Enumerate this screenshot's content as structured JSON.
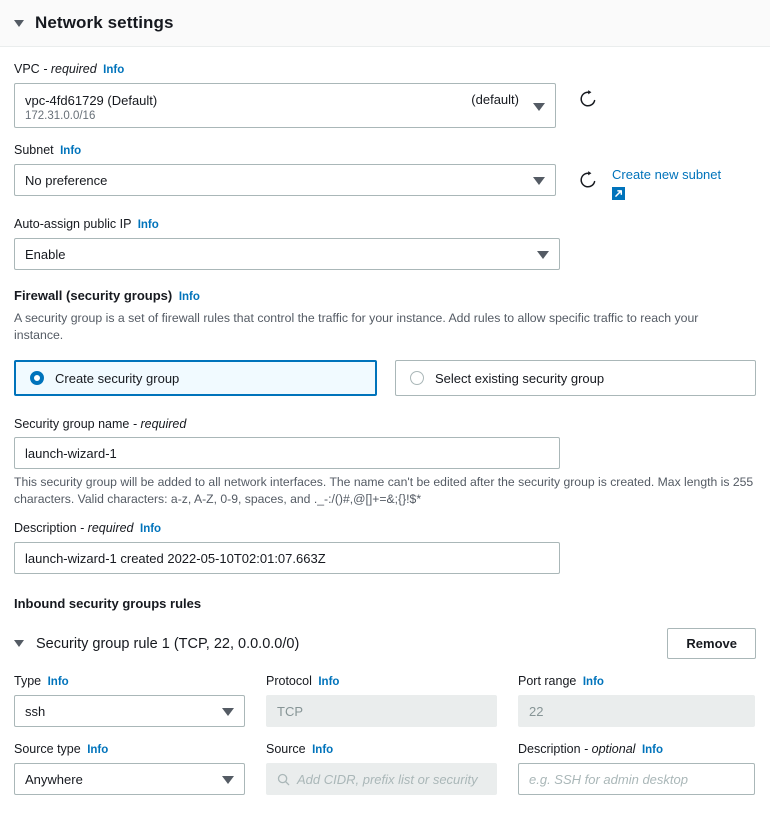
{
  "section": {
    "title": "Network settings",
    "collapse_icon": "caret-down-icon"
  },
  "vpc": {
    "label": "VPC",
    "required_suffix": "- required",
    "info": "Info",
    "value_line1": "vpc-4fd61729 (Default)",
    "value_line2": "172.31.0.0/16",
    "default_tag": "(default)",
    "refresh_icon": "refresh-icon"
  },
  "subnet": {
    "label": "Subnet",
    "info": "Info",
    "value": "No preference",
    "refresh_icon": "refresh-icon",
    "create_link": "Create new subnet",
    "external_icon": "external-link-icon"
  },
  "auto_assign_ip": {
    "label": "Auto-assign public IP",
    "info": "Info",
    "value": "Enable"
  },
  "firewall": {
    "label": "Firewall (security groups)",
    "info": "Info",
    "description": "A security group is a set of firewall rules that control the traffic for your instance. Add rules to allow specific traffic to reach your instance.",
    "options": [
      {
        "label": "Create security group",
        "selected": true
      },
      {
        "label": "Select existing security group",
        "selected": false
      }
    ]
  },
  "security_group_name": {
    "label": "Security group name",
    "required_suffix": "- required",
    "value": "launch-wizard-1",
    "hint": "This security group will be added to all network interfaces. The name can't be edited after the security group is created. Max length is 255 characters. Valid characters: a-z, A-Z, 0-9, spaces, and ._-:/()#,@[]+=&;{}!$*"
  },
  "description_field": {
    "label": "Description",
    "required_suffix": "- required",
    "info": "Info",
    "value": "launch-wizard-1 created 2022-05-10T02:01:07.663Z"
  },
  "inbound_rules": {
    "heading": "Inbound security groups rules",
    "rule": {
      "title": "Security group rule 1 (TCP, 22, 0.0.0.0/0)",
      "collapse_icon": "caret-down-icon",
      "remove_label": "Remove",
      "fields": {
        "type": {
          "label": "Type",
          "info": "Info",
          "value": "ssh",
          "control": "select"
        },
        "protocol": {
          "label": "Protocol",
          "info": "Info",
          "value": "TCP",
          "control": "disabled-input"
        },
        "port_range": {
          "label": "Port range",
          "info": "Info",
          "value": "22",
          "control": "disabled-input"
        },
        "source_type": {
          "label": "Source type",
          "info": "Info",
          "value": "Anywhere",
          "control": "select"
        },
        "source": {
          "label": "Source",
          "info": "Info",
          "placeholder": "Add CIDR, prefix list or security",
          "control": "search-input",
          "icon": "search-icon"
        },
        "rule_description": {
          "label": "Description",
          "optional_suffix": "- optional",
          "info": "Info",
          "placeholder": "e.g. SSH for admin desktop",
          "control": "input"
        }
      }
    }
  },
  "colors": {
    "link": "#0073bb",
    "border": "#aab7b8",
    "disabled_bg": "#eaeded",
    "text": "#16191f",
    "muted": "#545b64",
    "selected_tile_bg": "#f1faff"
  }
}
